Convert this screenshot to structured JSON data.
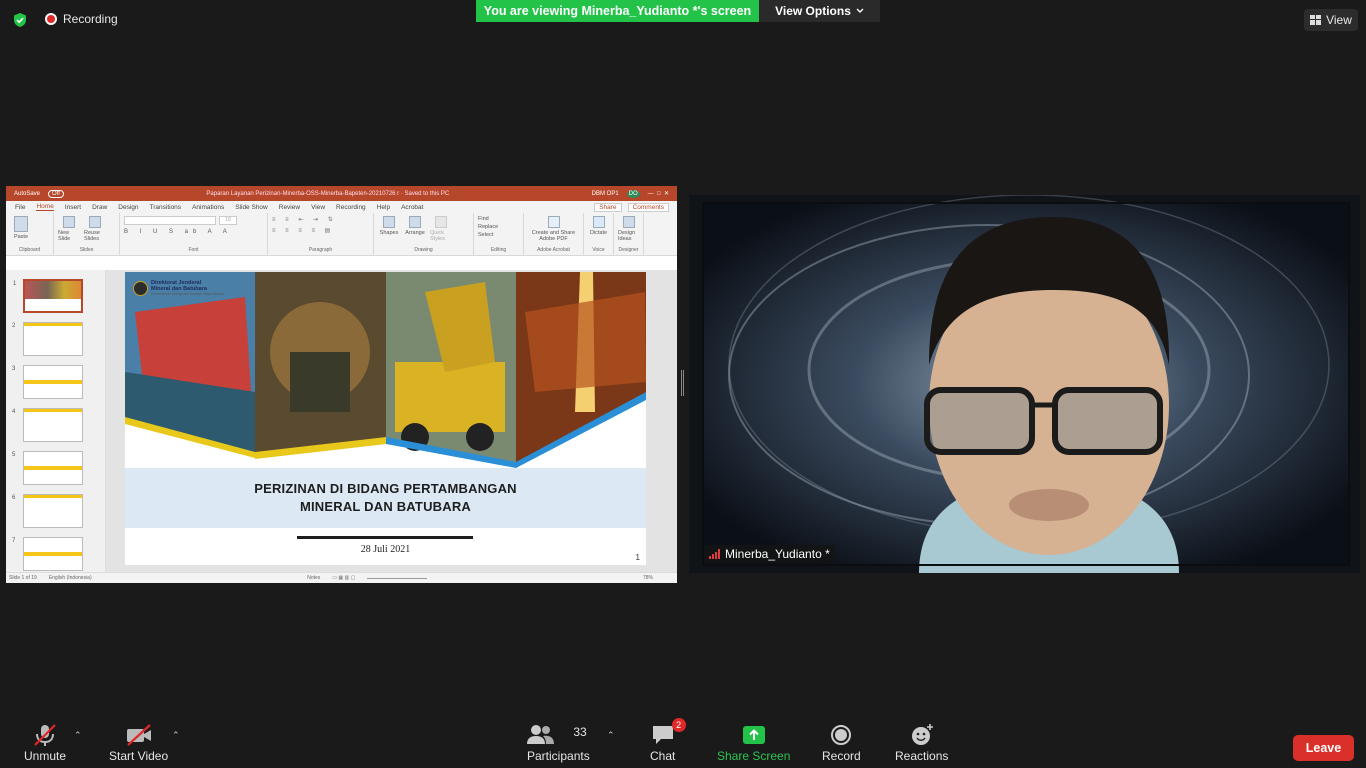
{
  "top": {
    "recording_label": "Recording",
    "viewing_banner": "You are viewing Minerba_Yudianto *'s screen",
    "view_options_label": "View Options",
    "view_label": "View"
  },
  "powerpoint": {
    "autosave": "AutoSave",
    "autosave_state": "Off",
    "doc_title": "Paparan Layanan Perizinan-Minerba-OSS-Minerba-Bapeten-20210726 r  ·  Saved to this PC",
    "user_name": "DBM OP1",
    "user_initials": "DO",
    "tabs": [
      "File",
      "Home",
      "Insert",
      "Draw",
      "Design",
      "Transitions",
      "Animations",
      "Slide Show",
      "Review",
      "View",
      "Recording",
      "Help",
      "Acrobat"
    ],
    "share": "Share",
    "comments": "Comments",
    "ribbon_groups": [
      {
        "label": "Clipboard",
        "buttons": [
          "Paste"
        ]
      },
      {
        "label": "Slides",
        "buttons": [
          "New Slide",
          "Reuse Slides"
        ]
      },
      {
        "label": "Font",
        "buttons": []
      },
      {
        "label": "Paragraph",
        "buttons": []
      },
      {
        "label": "Drawing",
        "buttons": [
          "Shapes",
          "Arrange",
          "Quick Styles"
        ]
      },
      {
        "label": "Editing",
        "buttons": [
          "Find",
          "Replace",
          "Select"
        ]
      },
      {
        "label": "Adobe Acrobat",
        "buttons": [
          "Create and Share Adobe PDF"
        ]
      },
      {
        "label": "Voice",
        "buttons": [
          "Dictate"
        ]
      },
      {
        "label": "Designer",
        "buttons": [
          "Design Ideas"
        ]
      }
    ],
    "font_size": "18",
    "thumb_numbers": [
      "1",
      "2",
      "3",
      "4",
      "5",
      "6",
      "7"
    ],
    "slide": {
      "logo_line1": "Direktorat Jenderal",
      "logo_line2": "Mineral dan Batubara",
      "logo_sub": "Kementerian Energi dan Sumber Daya Mineral",
      "title_line1": "PERIZINAN DI BIDANG PERTAMBANGAN",
      "title_line2": "MINERAL DAN BATUBARA",
      "date": "28 Juli 2021",
      "number": "1"
    },
    "status_slide": "Slide 1 of 19",
    "status_lang": "English (Indonesia)",
    "status_notes": "Notes",
    "status_zoom": "78%"
  },
  "video": {
    "participant_name": "Minerba_Yudianto *"
  },
  "toolbar": {
    "unmute": "Unmute",
    "start_video": "Start Video",
    "participants": "Participants",
    "participants_count": "33",
    "chat": "Chat",
    "chat_badge": "2",
    "share_screen": "Share Screen",
    "record": "Record",
    "reactions": "Reactions",
    "leave": "Leave"
  }
}
